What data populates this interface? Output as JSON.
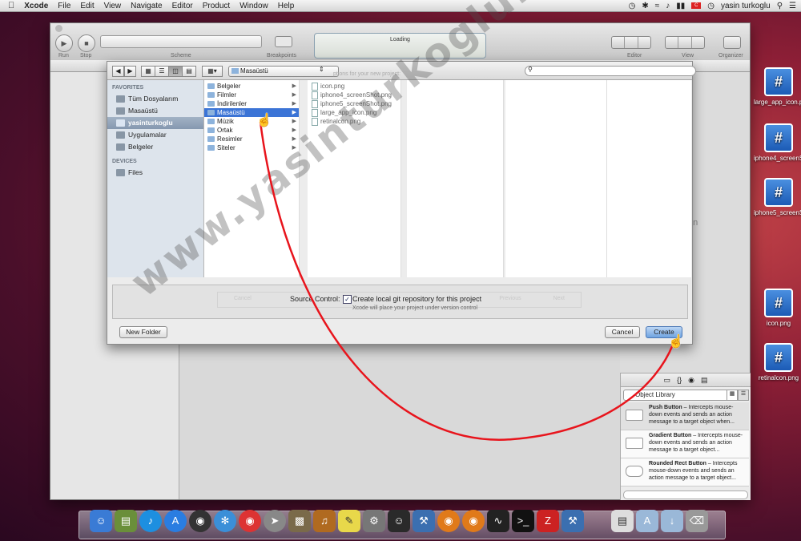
{
  "menubar": {
    "apple": "",
    "app": "Xcode",
    "items": [
      "File",
      "Edit",
      "View",
      "Navigate",
      "Editor",
      "Product",
      "Window",
      "Help"
    ],
    "flag": "C",
    "user": "yasin turkoglu"
  },
  "xcode": {
    "run_label": "Run",
    "stop_label": "Stop",
    "scheme_label": "Scheme",
    "breakpoints_label": "Breakpoints",
    "activity_text": "Loading",
    "editor_label": "Editor",
    "view_label": "View",
    "organizer_label": "Organizer",
    "partial_text": "ction",
    "library": {
      "select": "Object Library",
      "items": [
        {
          "name": "Push Button",
          "desc": "– Intercepts mouse-down events and sends an action message to a target object when..."
        },
        {
          "name": "Gradient Button",
          "desc": "– Intercepts mouse-down events and sends an action message to a target object..."
        },
        {
          "name": "Rounded Rect Button",
          "desc": "– Intercepts mouse-down events and sends an action message to a target object..."
        }
      ]
    }
  },
  "sheet": {
    "location": "Masaüstü",
    "search_placeholder": "",
    "sidebar": {
      "favorites_header": "FAVORITES",
      "favorites": [
        "Tüm Dosyalarım",
        "Masaüstü",
        "yasinturkoglu",
        "Uygulamalar",
        "Belgeler"
      ],
      "devices_header": "DEVICES",
      "devices": [
        "Files"
      ]
    },
    "col1": [
      "Belgeler",
      "Filmler",
      "İndirilenler",
      "Masaüstü",
      "Müzik",
      "Ortak",
      "Resimler",
      "Siteler"
    ],
    "col2": [
      "icon.png",
      "iphone4_screenShot.png",
      "iphone5_screenShot.png",
      "large_app_icon.png",
      "retinalcon.png"
    ],
    "ghost_text": "ptions for your new project:",
    "source_control_label": "Source Control:",
    "git_checkbox_label": "Create local git repository for this project",
    "git_sub": "Xcode will place your project under version control",
    "new_folder": "New Folder",
    "cancel": "Cancel",
    "create": "Create",
    "bg_buttons": [
      "Cancel",
      "Previous",
      "Next"
    ]
  },
  "desktop_icons": [
    {
      "label": "large_app_icon.png"
    },
    {
      "label": "iphone4_screenShot.png"
    },
    {
      "label": "iphone5_screenShot.png"
    },
    {
      "label": "icon.png"
    },
    {
      "label": "retinalcon.png"
    }
  ],
  "watermark": "www.yasinturkoglu.com",
  "colors": {
    "selection": "#3b74d6",
    "arrow": "#e8141c",
    "create_button": "#6fa3e0"
  }
}
